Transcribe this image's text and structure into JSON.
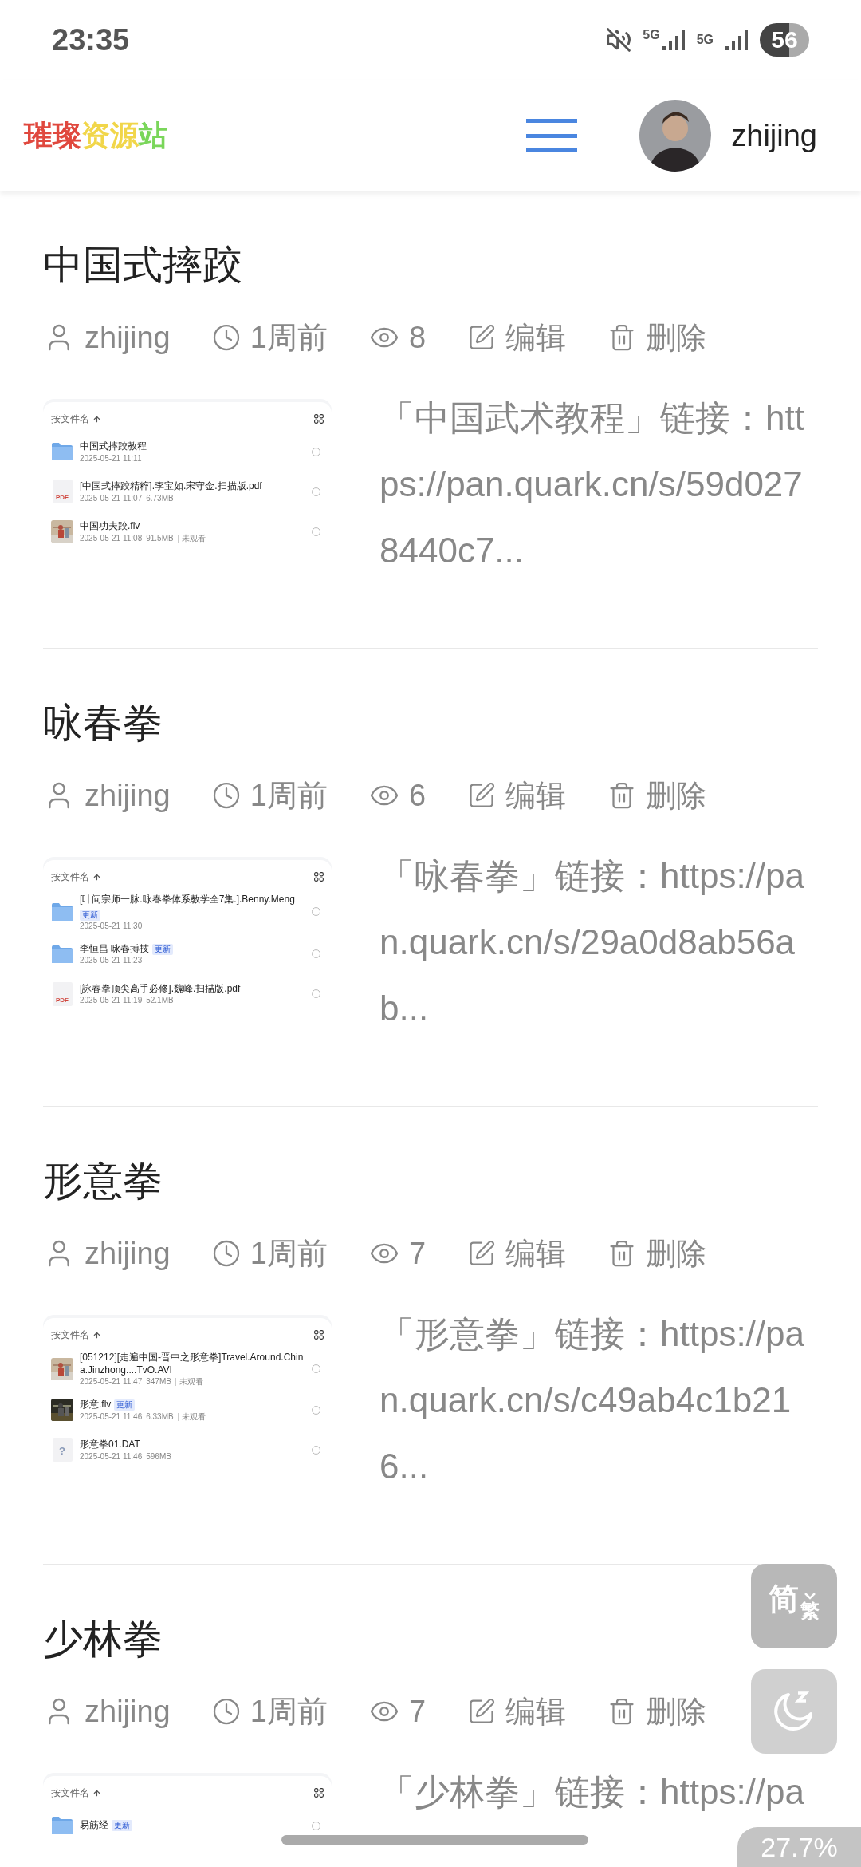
{
  "status_bar": {
    "time": "23:35",
    "network_labels": [
      "5G",
      "5G"
    ],
    "battery": "56"
  },
  "header": {
    "logo": [
      {
        "text": "璀璨",
        "color": "#e0483e"
      },
      {
        "text": "资源",
        "color": "#f1d64a"
      },
      {
        "text": "站",
        "color": "#7ad65a"
      }
    ],
    "user": "zhijing"
  },
  "posts": [
    {
      "title": "中国式摔跤",
      "author": "zhijing",
      "time": "1周前",
      "views": "8",
      "actions": [
        "编辑",
        "删除"
      ],
      "thumbnail": {
        "sort_label": "按文件名",
        "files": [
          {
            "kind": "folder",
            "name": "中国式摔跤教程",
            "date": "2025-05-21 11:11",
            "selected": false
          },
          {
            "kind": "document",
            "icon_label": "PDF",
            "name": "[中国式摔跤精粹].李宝如.宋守金.扫描版.pdf",
            "date": "2025-05-21 11:07",
            "size": "6.73MB",
            "selected": false
          },
          {
            "kind": "video",
            "name": "中国功夫跤.flv",
            "date": "2025-05-21 11:08",
            "size": "91.5MB",
            "status": "未观看",
            "selected": false
          }
        ]
      },
      "excerpt": "「中国武术教程」链接：https://pan.quark.cn/s/59d0278440c7..."
    },
    {
      "title": "咏春拳",
      "author": "zhijing",
      "time": "1周前",
      "views": "6",
      "actions": [
        "编辑",
        "删除"
      ],
      "thumbnail": {
        "sort_label": "按文件名",
        "files": [
          {
            "kind": "folder",
            "name": "[叶问宗师一脉.咏春拳体系教学全7集.].Benny.Meng",
            "badge": "更新",
            "date": "2025-05-21 11:30",
            "selected": false
          },
          {
            "kind": "folder",
            "name": "李恒昌 咏春搏技",
            "badge": "更新",
            "date": "2025-05-21 11:23",
            "selected": false
          },
          {
            "kind": "document",
            "icon_label": "PDF",
            "name": "[詠春拳顶尖高手必修].魏峰.扫描版.pdf",
            "date": "2025-05-21 11:19",
            "size": "52.1MB",
            "selected": false
          }
        ]
      },
      "excerpt": "「咏春拳」链接：https://pan.quark.cn/s/29a0d8ab56ab..."
    },
    {
      "title": "形意拳",
      "author": "zhijing",
      "time": "1周前",
      "views": "7",
      "actions": [
        "编辑",
        "删除"
      ],
      "thumbnail": {
        "sort_label": "按文件名",
        "files": [
          {
            "kind": "video",
            "name": "[051212][走遍中国-晋中之形意拳]Travel.Around.China.Jinzhong....TvO.AVI",
            "date": "2025-05-21 11:47",
            "size": "347MB",
            "status": "未观看",
            "selected": false
          },
          {
            "kind": "video",
            "name": "形意.flv",
            "badge": "更新",
            "date": "2025-05-21 11:46",
            "size": "6.33MB",
            "status": "未观看",
            "selected": false
          },
          {
            "kind": "document",
            "icon_label": "?",
            "name": "形意拳01.DAT",
            "date": "2025-05-21 11:46",
            "size": "596MB",
            "selected": false
          }
        ]
      },
      "excerpt": "「形意拳」链接：https://pan.quark.cn/s/c49ab4c1b216..."
    },
    {
      "title": "少林拳",
      "author": "zhijing",
      "time": "1周前",
      "views": "7",
      "actions": [
        "编辑",
        "删除"
      ],
      "thumbnail": {
        "sort_label": "按文件名",
        "files": [
          {
            "kind": "folder",
            "name": "易筋经",
            "badge": "更新",
            "selected": false
          }
        ]
      },
      "excerpt": "「少林拳」链接：https://pa"
    }
  ],
  "floating": {
    "convert_from": "简",
    "convert_to": "繁",
    "progress": "27.7%"
  }
}
